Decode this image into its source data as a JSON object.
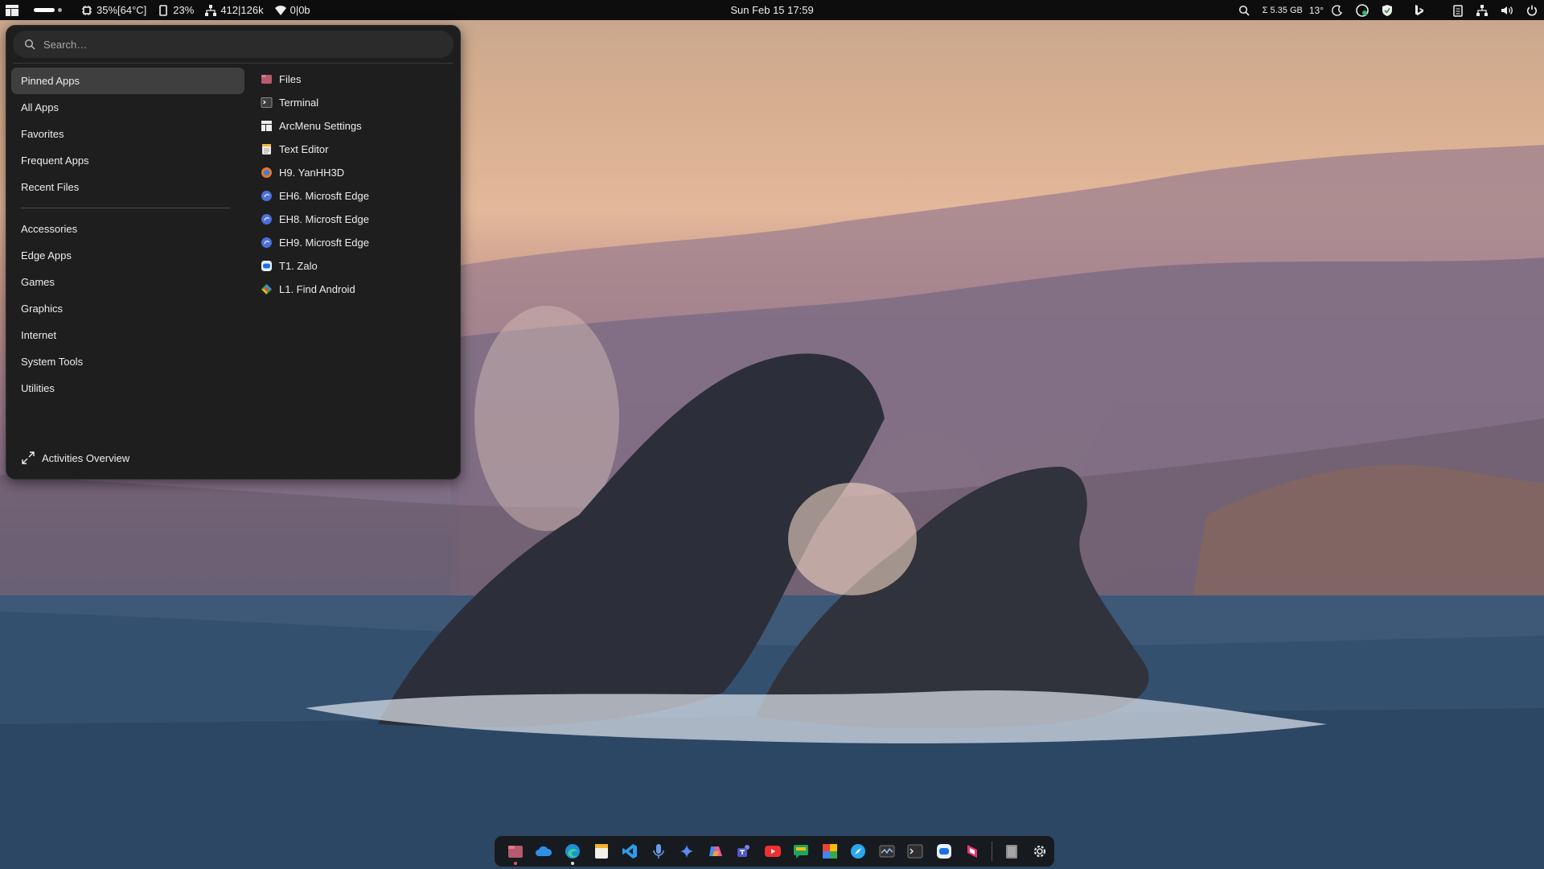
{
  "topbar": {
    "cpu": "35%[64°C]",
    "memory": "23%",
    "network_speed": "412|126k",
    "traffic": "0|0b",
    "clock": "Sun Feb 15  17:59",
    "storage": "Σ 5.35 GB",
    "weather": "13°",
    "icons_right": [
      "search-icon",
      "storage-stat",
      "weather-temp",
      "night-light-icon",
      "sync-icon",
      "shield-icon",
      "bing-icon",
      "clipboard-icon",
      "network-icon",
      "volume-icon",
      "power-icon"
    ]
  },
  "menu": {
    "search_placeholder": "Search…",
    "categories": [
      {
        "label": "Pinned Apps"
      },
      {
        "label": "All Apps"
      },
      {
        "label": "Favorites"
      },
      {
        "label": "Frequent Apps"
      },
      {
        "label": "Recent Files"
      }
    ],
    "groups": [
      {
        "label": "Accessories"
      },
      {
        "label": "Edge Apps"
      },
      {
        "label": "Games"
      },
      {
        "label": "Graphics"
      },
      {
        "label": "Internet"
      },
      {
        "label": "System Tools"
      },
      {
        "label": "Utilities"
      }
    ],
    "apps": [
      {
        "label": "Files",
        "icon": "files-icon"
      },
      {
        "label": "Terminal",
        "icon": "terminal-icon"
      },
      {
        "label": "ArcMenu Settings",
        "icon": "arcmenu-settings-icon"
      },
      {
        "label": "Text Editor",
        "icon": "text-editor-icon"
      },
      {
        "label": "H9. YanHH3D",
        "icon": "edge-app-icon"
      },
      {
        "label": "EH6. Microsft Edge",
        "icon": "edge-app-icon"
      },
      {
        "label": "EH8. Microsft Edge",
        "icon": "edge-app-icon"
      },
      {
        "label": "EH9. Microsft Edge",
        "icon": "edge-app-icon"
      },
      {
        "label": "T1. Zalo",
        "icon": "zalo-icon"
      },
      {
        "label": "L1. Find Android",
        "icon": "find-android-icon"
      }
    ],
    "activities_label": "Activities Overview"
  },
  "dock": {
    "items": [
      "files-icon",
      "onedrive-icon",
      "edge-icon",
      "notes-icon",
      "vscode-icon",
      "voice-recorder-icon",
      "gemini-icon",
      "copilot-icon",
      "teams-icon",
      "youtube-icon",
      "chat-icon",
      "photos-icon",
      "safari-icon",
      "system-monitor-icon",
      "terminal-icon",
      "zalo-icon",
      "diagram-icon",
      "trash-icon",
      "settings-icon"
    ]
  },
  "colors": {
    "menu_bg": "#1e1e1e",
    "active_category": "#3f3f3f",
    "topbar_bg": "#0d0d0d"
  }
}
